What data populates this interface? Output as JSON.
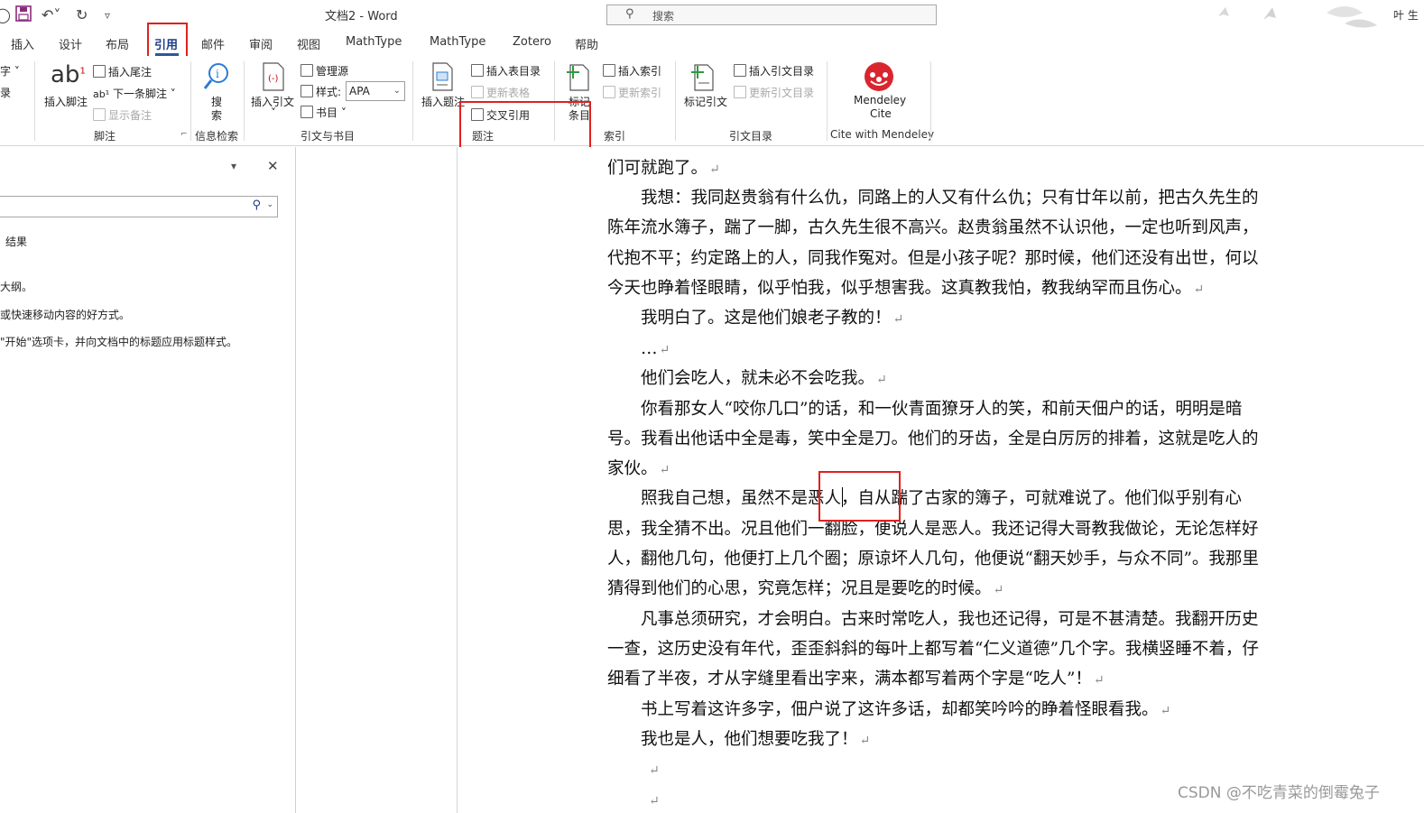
{
  "titlebar": {
    "doc_title": "文档2  -  Word",
    "search_placeholder": "搜索",
    "user_name": "叶 生"
  },
  "tabs": [
    {
      "label": "插入"
    },
    {
      "label": "设计"
    },
    {
      "label": "布局"
    },
    {
      "label": "引用"
    },
    {
      "label": "邮件"
    },
    {
      "label": "审阅"
    },
    {
      "label": "视图"
    },
    {
      "label": "MathType"
    },
    {
      "label": "MathType"
    },
    {
      "label": "Zotero"
    },
    {
      "label": "帮助"
    }
  ],
  "ribbon": {
    "toc_partial_1": "字",
    "toc_partial_2": "录",
    "footnotes": {
      "insert_footnote": "插入脚注",
      "insert_endnote": "插入尾注",
      "next_footnote": "下一条脚注",
      "show_notes": "显示备注",
      "group": "脚注"
    },
    "research": {
      "search": "搜",
      "search2": "索",
      "group": "信息检索"
    },
    "citations": {
      "insert_citation": "插入引文",
      "manage_sources": "管理源",
      "style_label": "样式:",
      "style_value": "APA",
      "bibliography": "书目",
      "group": "引文与书目"
    },
    "captions": {
      "insert_caption": "插入题注",
      "insert_table_of_figures": "插入表目录",
      "update_table": "更新表格",
      "cross_reference": "交叉引用",
      "group": "题注"
    },
    "index": {
      "mark_entry_1": "标记",
      "mark_entry_2": "条目",
      "insert_index": "插入索引",
      "update_index": "更新索引",
      "group": "索引"
    },
    "toa": {
      "mark_citation": "标记引文",
      "insert_toa": "插入引文目录",
      "update_toa": "更新引文目录",
      "group": "引文目录"
    },
    "mendeley": {
      "label1": "Mendeley",
      "label2": "Cite",
      "group": "Cite with Mendeley"
    }
  },
  "navpane": {
    "results": "结果",
    "line1": "大纲。",
    "line2": "或快速移动内容的好方式。",
    "line3": "\"开始\"选项卡，并向文档中的标题应用标题样式。"
  },
  "document": {
    "paragraphs": [
      "们可就跑了。",
      "　　我想：我同赵贵翁有什么仇，同路上的人又有什么仇；只有廿年以前，把古久先生的",
      "陈年流水簿子，踹了一脚，古久先生很不高兴。赵贵翁虽然不认识他，一定也听到风声，",
      "代抱不平；约定路上的人，同我作冤对。但是小孩子呢？那时候，他们还没有出世，何以",
      "今天也睁着怪眼睛，似乎怕我，似乎想害我。这真教我怕，教我纳罕而且伤心。",
      "　　我明白了。这是他们娘老子教的！",
      "　　…",
      "　　他们会吃人，就未必不会吃我。",
      "　　你看那女人“咬你几口”的话，和一伙青面獠牙人的笑，和前天佃户的话，明明是暗",
      "号。我看出他话中全是毒，笑中全是刀。他们的牙齿，全是白厉厉的排着，这就是吃人的",
      "家伙。",
      "　　照我自己想，虽然不是恶人，自从踹了古家的簿子，可就难说了。他们似乎别有心",
      "思，我全猜不出。况且他们一翻脸，便说人是恶人。我还记得大哥教我做论，无论怎样好",
      "人，翻他几句，他便打上几个圈；原谅坏人几句，他便说“翻天妙手，与众不同”。我那里",
      "猜得到他们的心思，究竟怎样；况且是要吃的时候。",
      "　　凡事总须研究，才会明白。古来时常吃人，我也还记得，可是不甚清楚。我翻开历史",
      "一查，这历史没有年代，歪歪斜斜的每叶上都写着“仁义道德”几个字。我横竖睡不着，仔",
      "细看了半夜，才从字缝里看出字来，满本都写着两个字是“吃人”！",
      "　　书上写着这许多字，佃户说了这许多话，却都笑吟吟的睁着怪眼看我。",
      "　　我也是人，他们想要吃我了！",
      "",
      ""
    ],
    "para_mark": "↵"
  },
  "watermark": "CSDN @不吃青菜的倒霉兔子"
}
